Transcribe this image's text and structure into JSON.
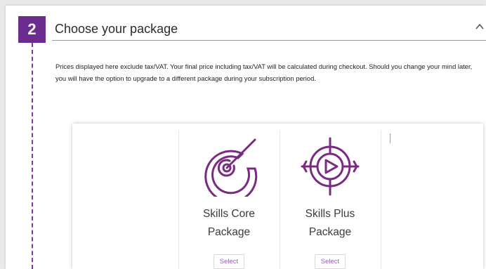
{
  "step": {
    "number": "2",
    "title": "Choose your package"
  },
  "description": "Prices displayed here exclude tax/VAT. Your final price including tax/VAT will be calculated during checkout. Should you change your mind later, you will have the option to upgrade to a different package during your subscription period.",
  "packages": [
    {
      "name_line1": "Skills Core",
      "name_line2": "Package",
      "select_label": "Select",
      "icon": "target-arrow-icon"
    },
    {
      "name_line1": "Skills Plus",
      "name_line2": "Package",
      "select_label": "Select",
      "icon": "crosshair-play-icon"
    }
  ],
  "colors": {
    "accent": "#6c2b8f",
    "icon": "#7a2a82",
    "button_text": "#9b5eb0"
  }
}
